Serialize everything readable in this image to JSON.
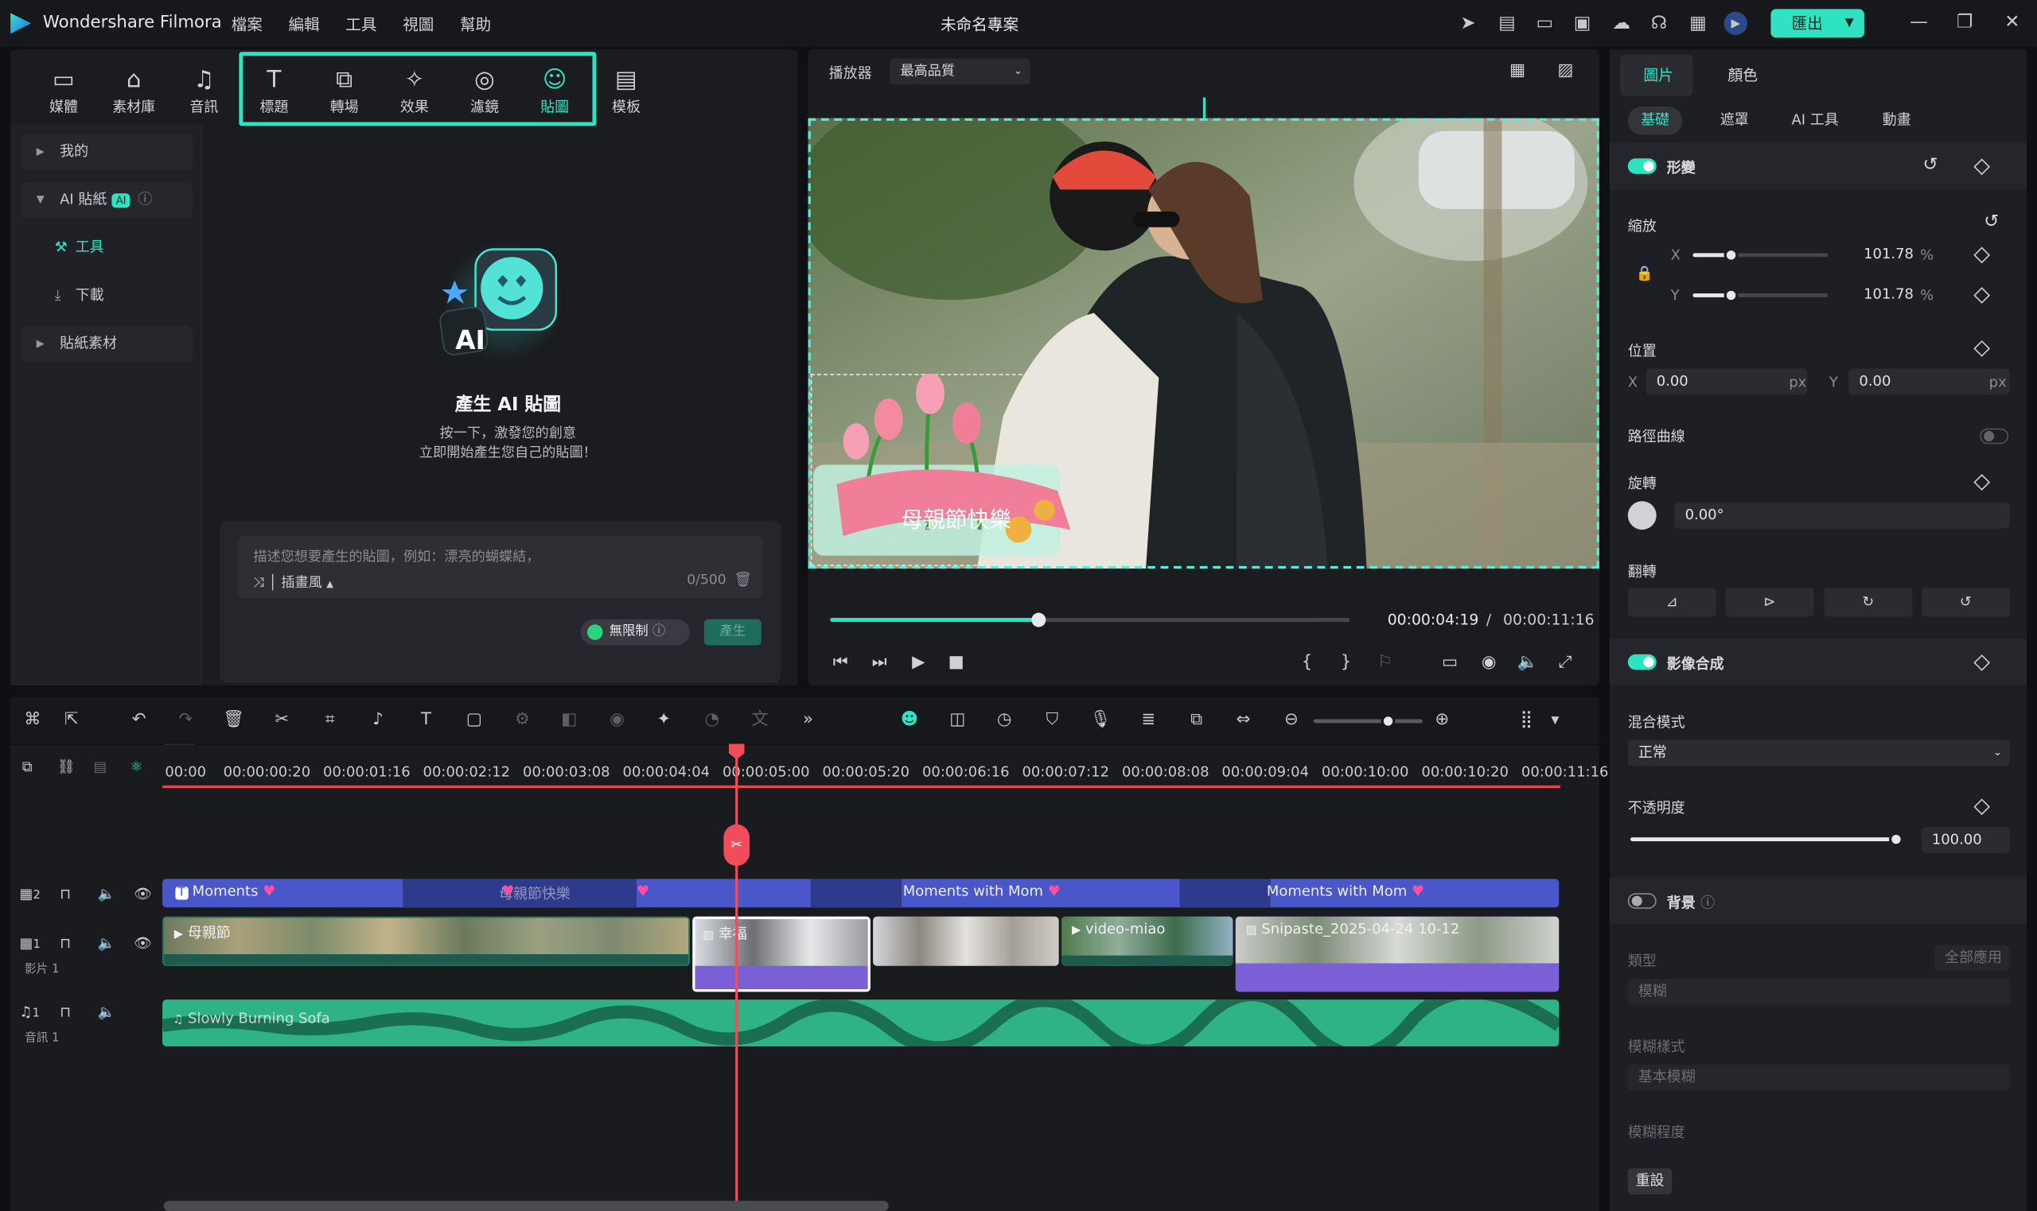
{
  "app": {
    "name": "Wondershare Filmora",
    "project": "未命名專案",
    "export_label": "匯出"
  },
  "menu": [
    "檔案",
    "編輯",
    "工具",
    "視圖",
    "幫助"
  ],
  "tools": [
    {
      "label": "媒體",
      "icon": "media-icon"
    },
    {
      "label": "素材庫",
      "icon": "stock-icon"
    },
    {
      "label": "音訊",
      "icon": "music-note-icon"
    },
    {
      "label": "標題",
      "icon": "title-t-icon"
    },
    {
      "label": "轉場",
      "icon": "transition-icon"
    },
    {
      "label": "效果",
      "icon": "effects-icon"
    },
    {
      "label": "濾鏡",
      "icon": "filter-icon"
    },
    {
      "label": "貼圖",
      "icon": "sticker-icon"
    },
    {
      "label": "模板",
      "icon": "template-icon"
    }
  ],
  "sidebar": {
    "mine": "我的",
    "ai_sticker": "AI 貼紙",
    "ai_badge": "AI",
    "tools": "工具",
    "download": "下載",
    "sticker_material": "貼紙素材"
  },
  "generator": {
    "title": "產生 AI 貼圖",
    "line1": "按一下，激發您的創意",
    "line2": "立即開始產生您自己的貼圖！",
    "placeholder": "描述您想要產生的貼圖，例如：漂亮的蝴蝶結，",
    "style": "插畫風",
    "count": "0/500",
    "unlimited": "無限制",
    "generate": "產生",
    "emblem_text": "AI"
  },
  "player": {
    "label": "播放器",
    "quality": "最高品質",
    "current_time": "00:00:04:19",
    "separator": "/",
    "duration": "00:00:11:16",
    "progress": 0.4,
    "sticker_text": "母親節快樂"
  },
  "properties": {
    "tabs": [
      "圖片",
      "顏色"
    ],
    "subtabs": [
      "基礎",
      "遮罩",
      "AI 工具",
      "動畫"
    ],
    "transform": "形變",
    "scale": "縮放",
    "x_label": "X",
    "y_label": "Y",
    "scale_x": "101.78",
    "scale_y": "101.78",
    "percent": "%",
    "position": "位置",
    "pos_x": "0.00",
    "pos_y": "0.00",
    "px": "px",
    "path_curve": "路徑曲線",
    "rotation": "旋轉",
    "rotation_value": "0.00°",
    "flip": "翻轉",
    "compositing": "影像合成",
    "blend_mode": "混合模式",
    "blend_value": "正常",
    "opacity": "不透明度",
    "opacity_value": "100.00",
    "background": "背景",
    "type": "類型",
    "apply_all": "全部應用",
    "type_value": "模糊",
    "blur_style": "模糊樣式",
    "blur_style_value": "基本模糊",
    "blur_level": "模糊程度",
    "reset": "重設"
  },
  "timeline": {
    "ruler": [
      "00:00",
      "00:00:00:20",
      "00:00:01:16",
      "00:00:02:12",
      "00:00:03:08",
      "00:00:04:04",
      "00:00:05:00",
      "00:00:05:20",
      "00:00:06:16",
      "00:00:07:12",
      "00:00:08:08",
      "00:00:09:04",
      "00:00:10:00",
      "00:00:10:20",
      "00:00:11:16"
    ],
    "track_title": {
      "num": "2",
      "clips": [
        "Moments",
        "母親節快樂",
        "Moments with Mom",
        "Moments with Mom"
      ]
    },
    "track_video": {
      "num": "1",
      "name": "影片 1",
      "clips": [
        "母親節",
        "幸福",
        "video-miao",
        "Snipaste_2025-04-24 10-12"
      ]
    },
    "track_audio": {
      "num": "1",
      "name": "音訊 1",
      "clip": "Slowly Burning Sofa"
    }
  },
  "colors": {
    "accent": "#2fe3c2",
    "playhead": "#f04c5a",
    "title_track": "#4a57c9",
    "audio_track": "#2fb386",
    "video_sel": "#7b5fd6"
  }
}
